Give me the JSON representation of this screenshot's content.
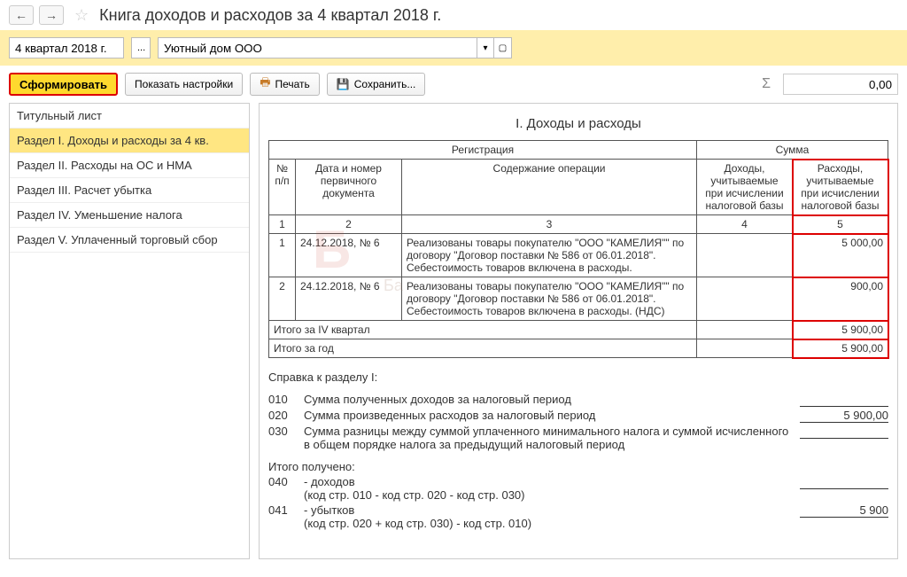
{
  "header": {
    "title": "Книга доходов и расходов за 4 квартал 2018 г."
  },
  "filters": {
    "period": "4 квартал 2018 г.",
    "organization": "Уютный дом ООО"
  },
  "toolbar": {
    "generate": "Сформировать",
    "show_settings": "Показать настройки",
    "print": "Печать",
    "save": "Сохранить...",
    "sum_value": "0,00"
  },
  "sidebar": {
    "items": [
      "Титульный лист",
      "Раздел I. Доходы и расходы за 4 кв.",
      "Раздел II. Расходы на ОС и НМА",
      "Раздел III. Расчет убытка",
      "Раздел IV. Уменьшение налога",
      "Раздел V. Уплаченный торговый сбор"
    ],
    "active_index": 1
  },
  "report": {
    "section_title": "I. Доходы и расходы",
    "table": {
      "group_headers": {
        "reg": "Регистрация",
        "sum": "Сумма"
      },
      "headers": {
        "num": "№ п/п",
        "date": "Дата и номер первичного документа",
        "op": "Содержание операции",
        "income": "Доходы, учитываемые при исчислении налоговой базы",
        "expense": "Расходы, учитываемые при исчислении налоговой базы"
      },
      "num_row": [
        "1",
        "2",
        "3",
        "4",
        "5"
      ],
      "rows": [
        {
          "n": "1",
          "date": "24.12.2018, № 6",
          "op": "Реализованы товары покупателю \"ООО \"КАМЕЛИЯ\"\" по договору \"Договор поставки № 586 от 06.01.2018\". Себестоимость товаров включена в расходы.",
          "income": "",
          "expense": "5 000,00"
        },
        {
          "n": "2",
          "date": "24.12.2018, № 6",
          "op": "Реализованы товары покупателю \"ООО \"КАМЕЛИЯ\"\" по договору \"Договор поставки № 586 от 06.01.2018\". Себестоимость товаров включена в расходы. (НДС)",
          "income": "",
          "expense": "900,00"
        }
      ],
      "totals": [
        {
          "label": "Итого за IV квартал",
          "income": "",
          "expense": "5 900,00"
        },
        {
          "label": "Итого за год",
          "income": "",
          "expense": "5 900,00"
        }
      ]
    },
    "spravka": {
      "title": "Справка к разделу I:",
      "rows": [
        {
          "code": "010",
          "text": "Сумма полученных доходов за налоговый период",
          "val": ""
        },
        {
          "code": "020",
          "text": "Сумма произведенных  расходов за налоговый период",
          "val": "5 900,00"
        },
        {
          "code": "030",
          "text": "Сумма разницы между  суммой уплаченного минимального налога и суммой исчисленного в общем порядке налога за предыдущий налоговый период",
          "val": ""
        }
      ],
      "itogo_label": "Итого получено:",
      "itogo": [
        {
          "code": "040",
          "text": "- доходов\n(код стр. 010 - код  стр. 020 - код стр. 030)",
          "val": ""
        },
        {
          "code": "041",
          "text": "- убытков\n(код стр. 020 + код  стр. 030) - код стр. 010)",
          "val": "5 900"
        }
      ]
    }
  }
}
